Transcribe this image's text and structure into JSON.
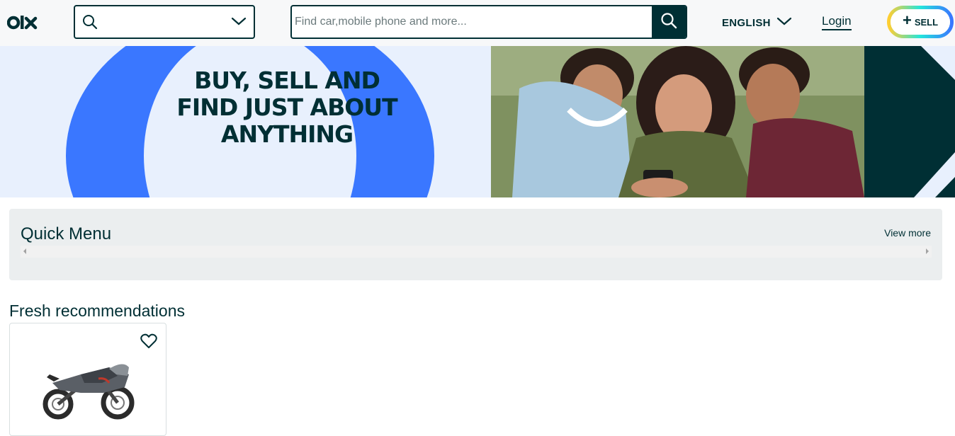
{
  "header": {
    "logo_text": "OLX",
    "search_placeholder": "Find car,mobile phone and more...",
    "language": "ENGLISH",
    "login": "Login",
    "sell": "SELL"
  },
  "banner": {
    "line1": "BUY, SELL AND",
    "line2": "FIND JUST ABOUT",
    "line3": "ANYTHING"
  },
  "quick_menu": {
    "title": "Quick Menu",
    "view_more": "View more"
  },
  "fresh": {
    "title": "Fresh recommendations"
  },
  "colors": {
    "brand_dark": "#002f34",
    "banner_blue": "#3a77ff",
    "banner_bg": "#e8f0fd"
  }
}
